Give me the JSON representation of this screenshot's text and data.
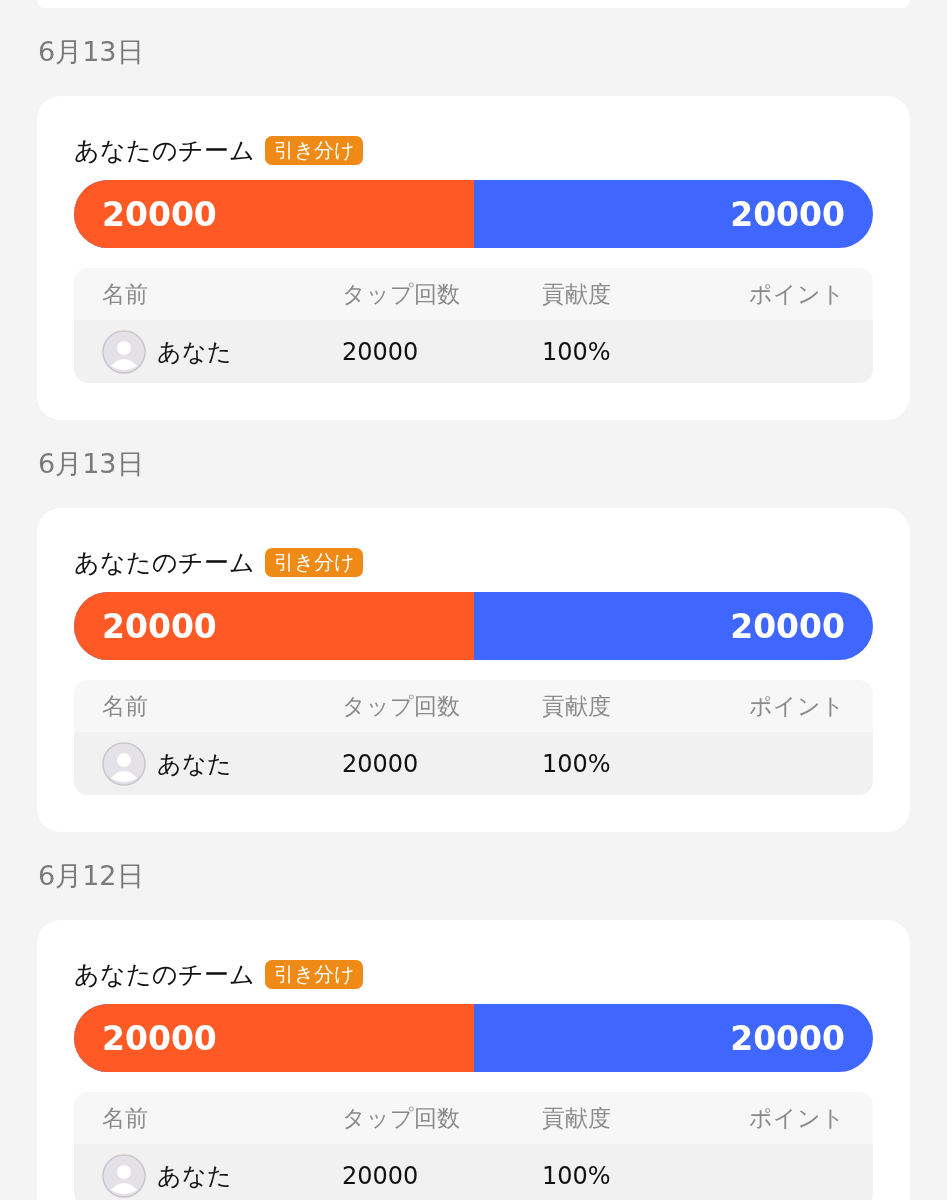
{
  "matches": [
    {
      "date": "6月13日",
      "team_label": "あなたのチーム",
      "result_badge": "引き分け",
      "left_score": "20000",
      "right_score": "20000",
      "level": 0.5,
      "columns": [
        "名前",
        "タップ回数",
        "貢献度",
        "ポイント"
      ],
      "rows": [
        {
          "name": "あなた",
          "taps": "20000",
          "contribution": "100%"
        }
      ]
    },
    {
      "date": "6月13日",
      "team_label": "あなたのチーム",
      "result_badge": "引き分け",
      "left_score": "20000",
      "right_score": "20000",
      "level": 0.5,
      "columns": [
        "名前",
        "タップ回数",
        "貢献度",
        "ポイント"
      ],
      "rows": [
        {
          "name": "あなた",
          "taps": "20000",
          "contribution": "100%"
        }
      ]
    },
    {
      "date": "6月12日",
      "team_label": "あなたのチーム",
      "result_badge": "引き分け",
      "left_score": "20000",
      "right_score": "20000",
      "level": 0.5,
      "columns": [
        "名前",
        "タップ回数",
        "貢献度",
        "ポイント"
      ],
      "rows": [
        {
          "name": "あなた",
          "taps": "20000",
          "contribution": "100%"
        }
      ]
    }
  ]
}
